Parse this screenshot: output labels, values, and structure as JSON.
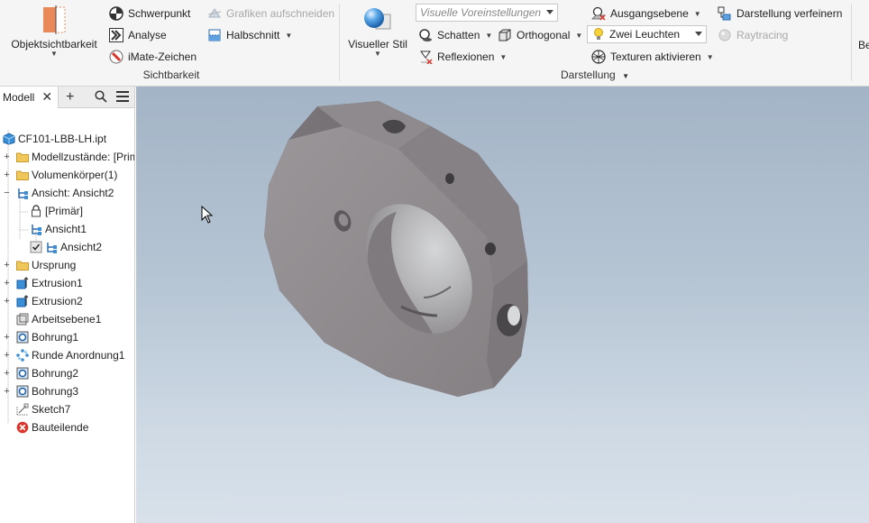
{
  "ribbon": {
    "sichtbarkeit": {
      "objektsichtbarkeit": "Objektsichtbarkeit",
      "schwerpunkt": "Schwerpunkt",
      "analyse": "Analyse",
      "imate": "iMate-Zeichen",
      "grafiken": "Grafiken aufschneiden",
      "halbschnitt": "Halbschnitt",
      "label": "Sichtbarkeit"
    },
    "darstellung": {
      "visueller_stil": "Visueller Stil",
      "voreinstellungen_placeholder": "Visuelle Voreinstellungen",
      "schatten": "Schatten",
      "orthogonal": "Orthogonal",
      "reflexionen": "Reflexionen",
      "ausgangsebene": "Ausgangsebene",
      "zwei_leuchten": "Zwei Leuchten",
      "texturen": "Texturen aktivieren",
      "darstellung_verfeinern": "Darstellung verfeinern",
      "raytracing": "Raytracing",
      "label": "Darstellung"
    },
    "next_group_initial": "Be"
  },
  "browser": {
    "tab_label": "Modell",
    "items": [
      {
        "label": "CF101-LBB-LH.ipt"
      },
      {
        "label": "Modellzustände: [Primär]"
      },
      {
        "label": "Volumenkörper(1)"
      },
      {
        "label": "Ansicht: Ansicht2"
      },
      {
        "label": "[Primär]"
      },
      {
        "label": "Ansicht1"
      },
      {
        "label": "Ansicht2"
      },
      {
        "label": "Ursprung"
      },
      {
        "label": "Extrusion1"
      },
      {
        "label": "Extrusion2"
      },
      {
        "label": "Arbeitsebene1"
      },
      {
        "label": "Bohrung1"
      },
      {
        "label": "Runde Anordnung1"
      },
      {
        "label": "Bohrung2"
      },
      {
        "label": "Bohrung3"
      },
      {
        "label": "Sketch7"
      },
      {
        "label": "Bauteilende"
      }
    ]
  },
  "colors": {
    "part_face": "#8b878a",
    "part_side": "#6f6b6f",
    "folder": "#f0c75a",
    "feature_blue": "#3a8fd6",
    "error_red": "#d9352b"
  }
}
